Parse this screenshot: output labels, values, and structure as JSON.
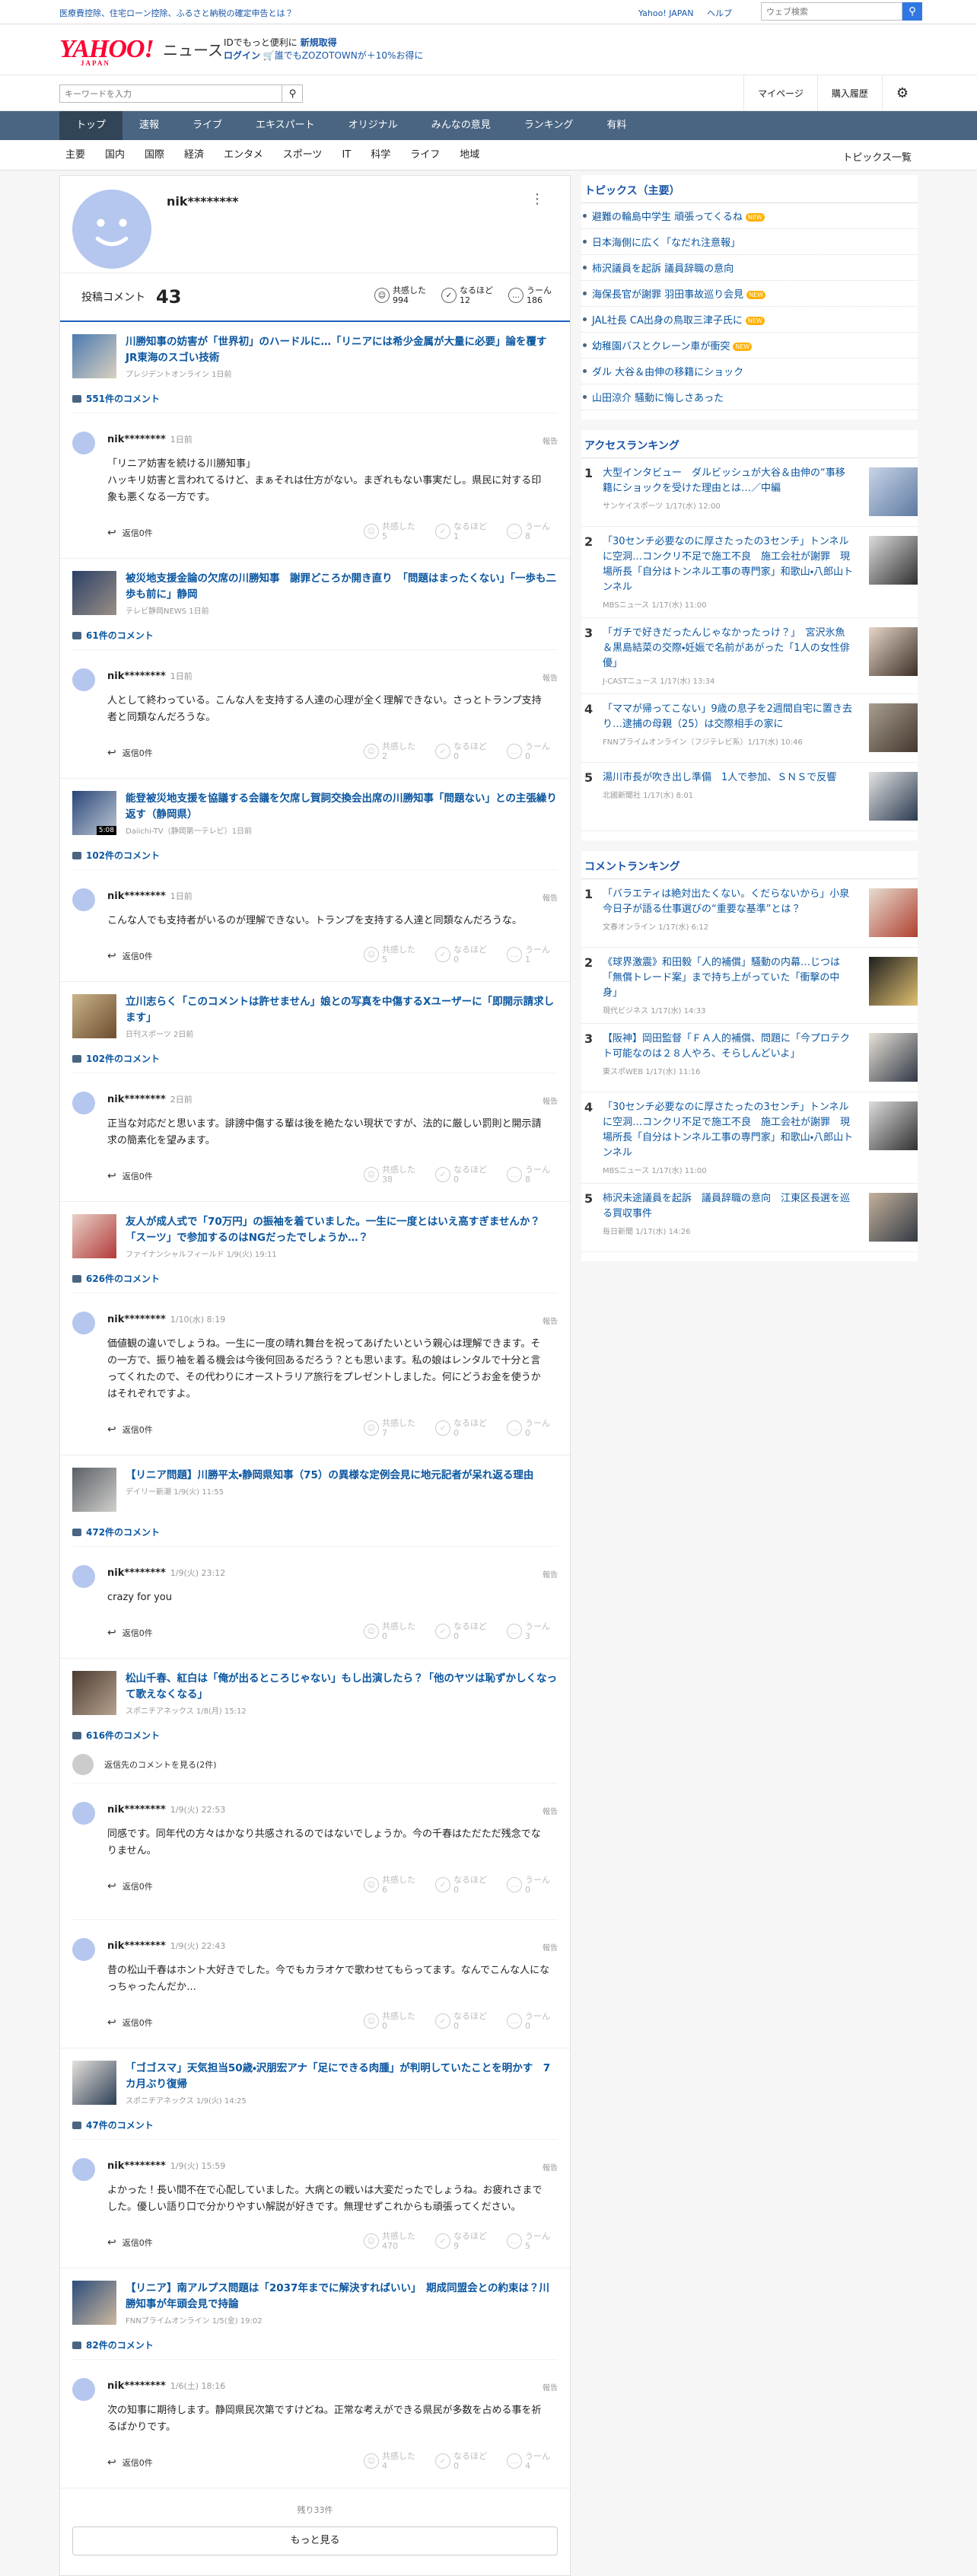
{
  "topbar": {
    "promo": "医療費控除、住宅ローン控除、ふるさと納税の確定申告とは？",
    "links": [
      "Yahoo! JAPAN",
      "ヘルプ"
    ],
    "search_placeholder": "ウェブ検索"
  },
  "header": {
    "logo": "YAHOO!",
    "logo_sub": "JAPAN",
    "site": "ニュース",
    "note_line1_a": "IDでもっと便利に",
    "note_line1_b": "新規取得",
    "note_line2_a": "ログイン",
    "note_line2_b": "誰でもZOZOTOWNが＋10%お得に"
  },
  "subbar": {
    "keyword_placeholder": "キーワードを入力",
    "mypage": "マイページ",
    "history": "購入履歴"
  },
  "nav": [
    "トップ",
    "速報",
    "ライブ",
    "エキスパート",
    "オリジナル",
    "みんなの意見",
    "ランキング",
    "有料"
  ],
  "categories": [
    "主要",
    "国内",
    "国際",
    "経済",
    "エンタメ",
    "スポーツ",
    "IT",
    "科学",
    "ライフ",
    "地域"
  ],
  "categories_all": "トピックス一覧",
  "profile": {
    "name": "nik********",
    "posts_label": "投稿コメント",
    "posts_count": "43",
    "reacts": [
      {
        "icon": "☺",
        "label": "共感した",
        "count": "994"
      },
      {
        "icon": "✓",
        "label": "なるほど",
        "count": "12"
      },
      {
        "icon": "…",
        "label": "うーん",
        "count": "186"
      }
    ]
  },
  "labels": {
    "report": "報告",
    "reply": "返信",
    "reply_count": "0件",
    "agree": "共感した",
    "nod": "なるほど",
    "hmm": "うーん",
    "replies_link": "返信先のコメントを見る(2件)",
    "remaining": "残り33件",
    "more": "もっと見る"
  },
  "items": [
    {
      "title": "川勝知事の妨害が「世界初」のハードルに…「リニアには希少金属が大量に必要」論を覆すJR東海のスゴい技術",
      "source": "プレジデントオンライン 1日前",
      "comments_count": "551件のコメント",
      "comments": [
        {
          "user": "nik********",
          "time": "1日前",
          "text": "「リニア妨害を続ける川勝知事」\nハッキリ妨害と言われてるけど、まぁそれは仕方がない。まぎれもない事実だし。県民に対する印象も悪くなる一方です。",
          "agree": "5",
          "nod": "1",
          "hmm": "8"
        }
      ]
    },
    {
      "title": "被災地支援金論の欠席の川勝知事　謝罪どころか開き直り　「問題はまったくない」「一歩も二歩も前に」静岡",
      "source": "テレビ静岡NEWS 1日前",
      "comments_count": "61件のコメント",
      "comments": [
        {
          "user": "nik********",
          "time": "1日前",
          "text": "人として終わっている。こんな人を支持する人達の心理が全く理解できない。さっとトランプ支持者と同類なんだろうな。",
          "agree": "2",
          "nod": "0",
          "hmm": "0"
        }
      ]
    },
    {
      "title": "能登被災地支援を協議する会議を欠席し賀詞交換会出席の川勝知事「問題ない」との主張繰り返す（静岡県）",
      "source": "Daiichi-TV（静岡第一テレビ）1日前",
      "duration": "5:08",
      "comments_count": "102件のコメント",
      "comments": [
        {
          "user": "nik********",
          "time": "1日前",
          "text": "こんな人でも支持者がいるのが理解できない。トランプを支持する人達と同類なんだろうな。",
          "agree": "5",
          "nod": "0",
          "hmm": "1"
        }
      ]
    },
    {
      "title": "立川志らく「このコメントは許せません」娘との写真を中傷するXユーザーに「即開示請求します」",
      "source": "日刊スポーツ 2日前",
      "comments_count": "102件のコメント",
      "comments": [
        {
          "user": "nik********",
          "time": "2日前",
          "text": "正当な対応だと思います。誹謗中傷する輩は後を絶たない現状ですが、法的に厳しい罰則と開示請求の簡素化を望みます。",
          "agree": "38",
          "nod": "0",
          "hmm": "8"
        }
      ]
    },
    {
      "title": "友人が成人式で「70万円」の振袖を着ていました。一生に一度とはいえ高すぎませんか？「スーツ」で参加するのはNGだったでしょうか…？",
      "source": "ファイナンシャルフィールド 1/9(火) 19:11",
      "comments_count": "626件のコメント",
      "comments": [
        {
          "user": "nik********",
          "time": "1/10(水) 8:19",
          "text": "価値観の違いでしょうね。一生に一度の晴れ舞台を祝ってあげたいという親心は理解できます。その一方で、振り袖を着る機会は今後何回あるだろう？とも思います。私の娘はレンタルで十分と言ってくれたので、その代わりにオーストラリア旅行をプレゼントしました。何にどうお金を使うかはそれぞれですよ。",
          "agree": "7",
          "nod": "0",
          "hmm": "0"
        }
      ]
    },
    {
      "title": "【リニア問題】川勝平太・静岡県知事（75）の異様な定例会見に地元記者が呆れ返る理由",
      "source": "デイリー新潮 1/9(火) 11:55",
      "comments_count": "472件のコメント",
      "comments": [
        {
          "user": "nik********",
          "time": "1/9(火) 23:12",
          "text": "crazy for you",
          "agree": "0",
          "nod": "0",
          "hmm": "3"
        }
      ]
    },
    {
      "title": "松山千春、紅白は「俺が出るところじゃない」もし出演したら？「他のヤツは恥ずかしくなって歌えなくなる」",
      "source": "スポニチアネックス 1/8(月) 15:12",
      "comments_count": "616件のコメント",
      "has_replies_link": true,
      "comments": [
        {
          "user": "nik********",
          "time": "1/9(火) 22:53",
          "text": "同感です。同年代の方々はかなり共感されるのではないでしょうか。今の千春はただただ残念でなりません。",
          "agree": "6",
          "nod": "0",
          "hmm": "0"
        },
        {
          "user": "nik********",
          "time": "1/9(火) 22:43",
          "text": "昔の松山千春はホント大好きでした。今でもカラオケで歌わせてもらってます。なんでこんな人になっちゃったんだか…",
          "agree": "0",
          "nod": "0",
          "hmm": "0"
        }
      ]
    },
    {
      "title": "「ゴゴスマ」天気担当50歳・沢朋宏アナ「足にできる肉腫」が判明していたことを明かす　7カ月ぶり復帰",
      "source": "スポニチアネックス 1/9(火) 14:25",
      "comments_count": "47件のコメント",
      "comments": [
        {
          "user": "nik********",
          "time": "1/9(火) 15:59",
          "text": "よかった！長い間不在で心配していました。大病との戦いは大変だったでしょうね。お疲れさまでした。優しい語り口で分かりやすい解説が好きです。無理せずこれからも頑張ってください。",
          "agree": "470",
          "nod": "9",
          "hmm": "5"
        }
      ]
    },
    {
      "title": "【リニア】南アルプス問題は「2037年までに解決すればいい」　期成同盟会との約束は？川勝知事が年頭会見で持論",
      "source": "FNNプライムオンライン 1/5(金) 19:02",
      "comments_count": "82件のコメント",
      "comments": [
        {
          "user": "nik********",
          "time": "1/6(土) 18:16",
          "text": "次の知事に期待します。静岡県民次第ですけどね。正常な考えができる県民が多数を占める事を祈るばかりです。",
          "agree": "4",
          "nod": "0",
          "hmm": "4"
        }
      ]
    }
  ],
  "sidebar": {
    "topics_title": "トピックス（主要）",
    "topics": [
      {
        "text": "避難の輪島中学生 頑張ってくるね",
        "new": true
      },
      {
        "text": "日本海側に広く「なだれ注意報」",
        "new": false
      },
      {
        "text": "柿沢議員を起訴 議員辞職の意向",
        "new": false
      },
      {
        "text": "海保長官が謝罪 羽田事故巡り会見",
        "new": true
      },
      {
        "text": "JAL社長 CA出身の鳥取三津子氏に",
        "new": true
      },
      {
        "text": "幼稚園バスとクレーン車が衝突",
        "new": true
      },
      {
        "text": "ダル 大谷＆由伸の移籍にショック",
        "new": false
      },
      {
        "text": "山田涼介 騒動に悔しさあった",
        "new": false
      }
    ],
    "new_label": "NEW",
    "access_title": "アクセスランキング",
    "access": [
      {
        "num": "1",
        "text": "大型インタビュー　ダルビッシュが大谷＆由伸の“事移籍にショックを受けた理由とは…／中編",
        "src": "サンケイスポーツ 1/17(水) 12:00"
      },
      {
        "num": "2",
        "text": "「30センチ必要なのに厚さたったの3センチ」トンネルに空洞…コンクリ不足で施工不良　施工会社が謝罪　現場所長「自分はトンネル工事の専門家」和歌山・八郎山トンネル",
        "src": "MBSニュース 1/17(水) 11:00"
      },
      {
        "num": "3",
        "text": "「ガチで好きだったんじゃなかったっけ？」　宮沢氷魚＆黒島結菜の交際・妊娠で名前があがった「1人の女性俳優」",
        "src": "J-CASTニュース 1/17(水) 13:34"
      },
      {
        "num": "4",
        "text": "「ママが帰ってこない」9歳の息子を2週間自宅に置き去り…逮捕の母親（25）は交際相手の家に",
        "src": "FNNプライムオンライン（フジテレビ系）1/17(水) 10:46"
      },
      {
        "num": "5",
        "text": "湯川市長が吹き出し準備　1人で参加、ＳＮＳで反響",
        "src": "北國新聞社 1/17(水) 8:01"
      }
    ],
    "comment_title": "コメントランキング",
    "comment_rank": [
      {
        "num": "1",
        "text": "「バラエティは絶対出たくない。くだらないから」小泉今日子が語る仕事選びの“重要な基準”とは？",
        "src": "文春オンライン 1/17(水) 6:12"
      },
      {
        "num": "2",
        "text": "《球界激震》和田毅「人的補償」騒動の内幕…じつは「無償トレード案」まで持ち上がっていた「衝撃の中身」",
        "src": "現代ビジネス 1/17(水) 14:33"
      },
      {
        "num": "3",
        "text": "【阪神】岡田監督「ＦＡ人的補償、問題に「今プロテクト可能なのは２８人やろ、そらしんどいよ」",
        "src": "東スポWEB 1/17(水) 11:16"
      },
      {
        "num": "4",
        "text": "「30センチ必要なのに厚さたったの3センチ」トンネルに空洞…コンクリ不足で施工不良　施工会社が謝罪　現場所長「自分はトンネル工事の専門家」和歌山・八郎山トンネル",
        "src": "MBSニュース 1/17(水) 11:00"
      },
      {
        "num": "5",
        "text": "柿沢未途議員を起訴　議員辞職の意向　江東区長選を巡る買収事件",
        "src": "毎日新聞 1/17(水) 14:26"
      }
    ]
  }
}
